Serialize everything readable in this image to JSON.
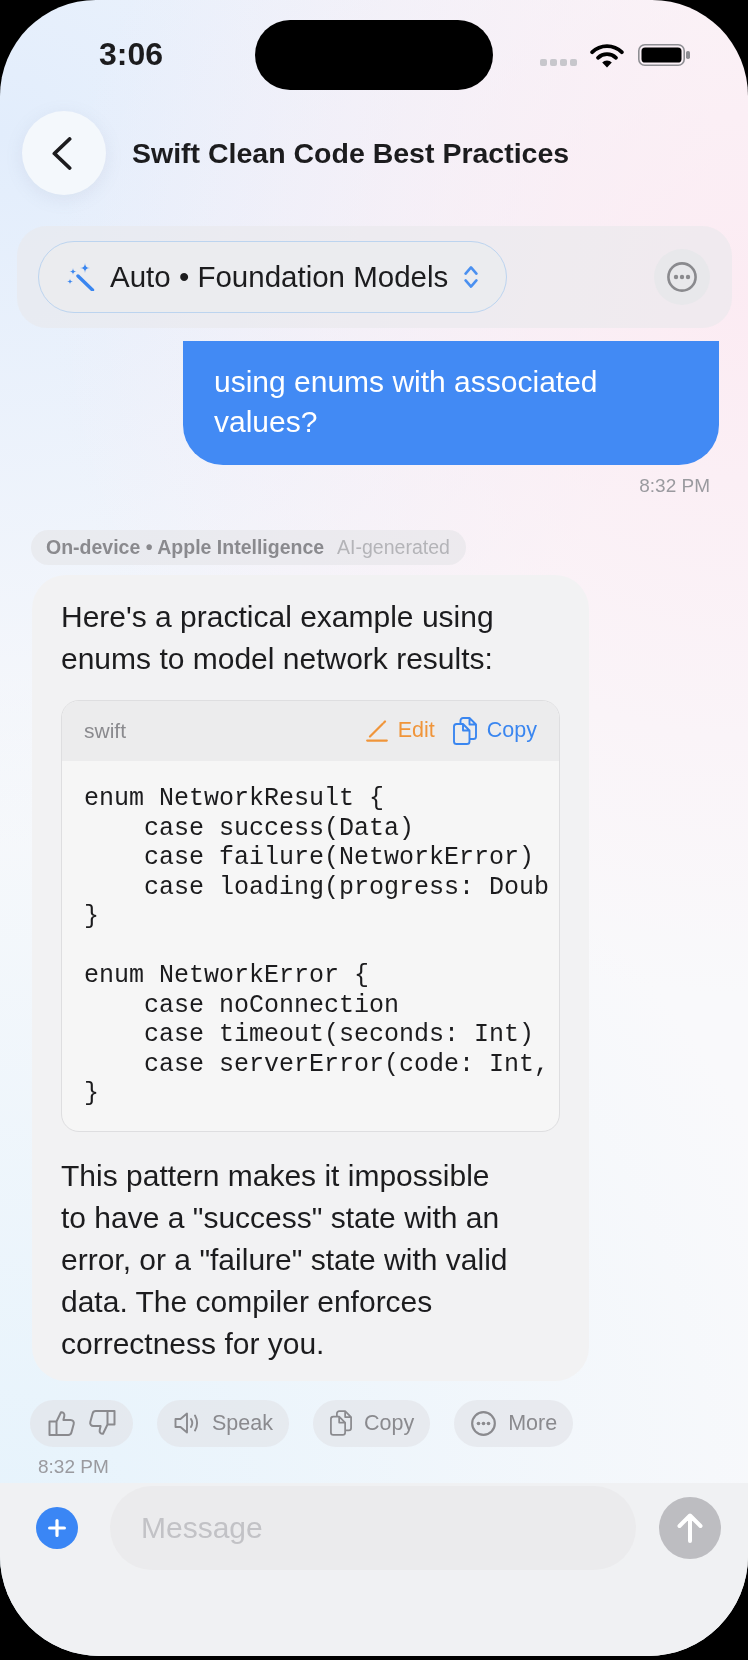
{
  "status_bar": {
    "time": "3:06"
  },
  "header": {
    "title": "Swift Clean Code Best Practices"
  },
  "model_selector": {
    "label": "Auto • Foundation Models"
  },
  "messages": [
    {
      "kind": "user",
      "text": "using enums with associated values?",
      "time": "8:32 PM"
    },
    {
      "kind": "assistant",
      "source": "On-device • Apple Intelligence",
      "tag": "AI-generated",
      "parts": [
        {
          "kind": "text",
          "text": "Here's a practical example using enums to model network results:"
        },
        {
          "kind": "code",
          "language": "swift",
          "actions": [
            {
              "kind": "edit",
              "label": "Edit"
            },
            {
              "kind": "copy",
              "label": "Copy"
            }
          ],
          "code": "enum NetworkResult {\n    case success(Data)\n    case failure(NetworkError)\n    case loading(progress: Doub\n}\n\nenum NetworkError {\n    case noConnection\n    case timeout(seconds: Int)\n    case serverError(code: Int,\n}"
        },
        {
          "kind": "text",
          "text": "This pattern makes it impossible to have a \"success\" state with an error, or a \"failure\" state with valid data. The compiler enforces correctness for you."
        }
      ],
      "actions": [
        {
          "kind": "feedback"
        },
        {
          "kind": "speak",
          "label": "Speak"
        },
        {
          "kind": "copy",
          "label": "Copy"
        },
        {
          "kind": "more",
          "label": "More"
        }
      ],
      "time": "8:32 PM"
    }
  ],
  "composer": {
    "placeholder": "Message"
  }
}
